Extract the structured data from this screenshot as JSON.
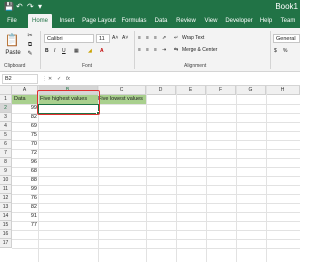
{
  "titlebar": {
    "document": "Book1"
  },
  "ribbon_tabs": [
    "File",
    "Home",
    "Insert",
    "Page Layout",
    "Formulas",
    "Data",
    "Review",
    "View",
    "Developer",
    "Help",
    "Team"
  ],
  "ribbon": {
    "paste_label": "Paste",
    "font_name": "Calibri",
    "font_size": "11",
    "wrap_text": "Wrap Text",
    "merge_center": "Merge & Center",
    "number_format": "General",
    "groups": {
      "clipboard": "Clipboard",
      "font": "Font",
      "alignment": "Alignment"
    }
  },
  "formula_bar": {
    "name_box": "B2",
    "fx": "fx",
    "content": ""
  },
  "grid": {
    "columns": [
      "A",
      "B",
      "C",
      "D",
      "E",
      "F",
      "G",
      "H"
    ],
    "rows": [
      "1",
      "2",
      "3",
      "4",
      "5",
      "6",
      "7",
      "8",
      "9",
      "10",
      "11",
      "12",
      "13",
      "14",
      "15",
      "16",
      "17"
    ],
    "headers": {
      "A1": "Data",
      "B1": "Five highest values",
      "C1": "Five lowest values"
    },
    "data_values": [
      "99",
      "82",
      "69",
      "75",
      "70",
      "72",
      "96",
      "68",
      "88",
      "99",
      "76",
      "82",
      "91",
      "77"
    ],
    "selected_cell": "B2",
    "highlight_color": "#a9d08e",
    "accent_color": "#217346",
    "annotation_color": "#e03030"
  }
}
